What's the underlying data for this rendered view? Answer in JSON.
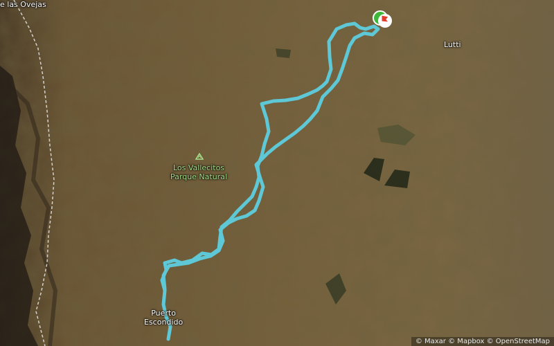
{
  "map": {
    "places": {
      "top_left": "e las Ovejas",
      "lutti": "Lutti",
      "park_line1": "Los Vallecitos",
      "park_line2": "Parque Natural",
      "puerto_line1": "Puerto",
      "puerto_line2": "Escondido"
    },
    "attribution": "© Maxar © Mapbox © OpenStreetMap",
    "colors": {
      "route": "#5ec8d6",
      "start": "#3fb83a",
      "finish": "#e23b2e",
      "terrain": "#6b5a3c",
      "park_label": "#a7e08a",
      "boundary": "#e9e9e9"
    },
    "icons": {
      "park": "park-triangle-icon",
      "start": "start-marker-icon",
      "finish": "finish-flag-icon"
    }
  }
}
